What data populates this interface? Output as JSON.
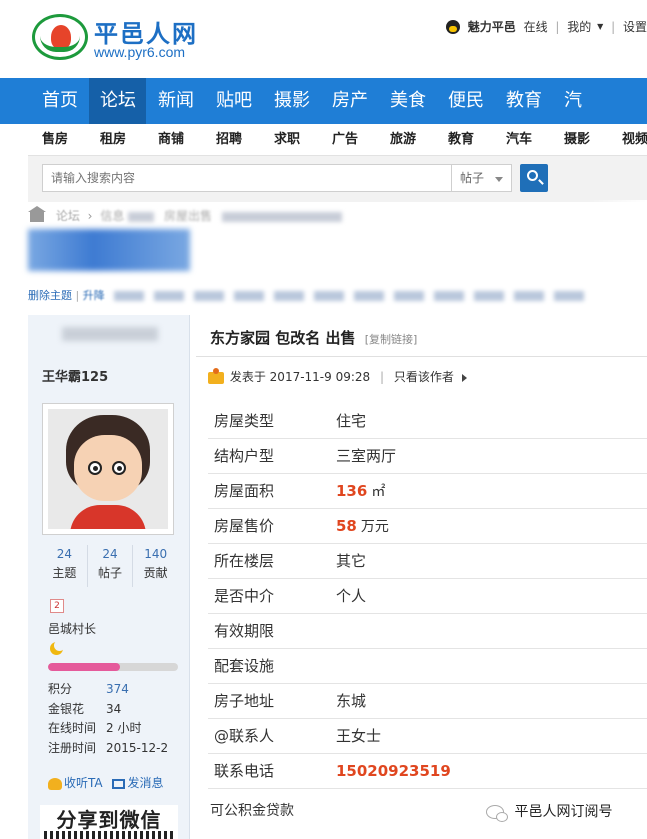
{
  "header": {
    "logo_name": "平邑人网",
    "logo_url": "www.pyr6.com",
    "topbar": {
      "user": "魅力平邑",
      "status": "在线",
      "mine": "我的",
      "settings": "设置"
    }
  },
  "mainnav": [
    "首页",
    "论坛",
    "新闻",
    "贴吧",
    "摄影",
    "房产",
    "美食",
    "便民",
    "教育",
    "汽"
  ],
  "mainnav_active": "论坛",
  "subnav": [
    "售房",
    "租房",
    "商铺",
    "招聘",
    "求职",
    "广告",
    "旅游",
    "教育",
    "汽车",
    "摄影",
    "视频"
  ],
  "search": {
    "placeholder": "请输入搜索内容",
    "scope": "帖子"
  },
  "breadcrumb": {
    "forum": "论坛",
    "section": "信息",
    "board": "房屋出售"
  },
  "manage": {
    "delete": "删除主题",
    "upgrade": "升降"
  },
  "user": {
    "name": "王华霸125",
    "stats": [
      {
        "num": "24",
        "label": "主题"
      },
      {
        "num": "24",
        "label": "帖子"
      },
      {
        "num": "140",
        "label": "贡献"
      }
    ],
    "level_badge": "2",
    "rank": "邑城村长",
    "level_progress": 0.55,
    "info": [
      {
        "k": "积分",
        "v": "374",
        "blue": true
      },
      {
        "k": "金银花",
        "v": "34",
        "blue": false
      },
      {
        "k": "在线时间",
        "v": "2 小时",
        "blue": false
      },
      {
        "k": "注册时间",
        "v": "2015-12-2",
        "blue": false
      }
    ],
    "follow": "收听TA",
    "message": "发消息",
    "wechat": "分享到微信"
  },
  "post": {
    "title": "东方家园 包改名 出售",
    "copy_link": "[复制链接]",
    "posted_prefix": "发表于",
    "posted_time": "2017-11-9 09:28",
    "author_only": "只看该作者",
    "fields": [
      {
        "k": "房屋类型",
        "v": "住宅",
        "red": false,
        "unit": ""
      },
      {
        "k": "结构户型",
        "v": "三室两厅",
        "red": false,
        "unit": ""
      },
      {
        "k": "房屋面积",
        "v": "136",
        "red": true,
        "unit": "㎡"
      },
      {
        "k": "房屋售价",
        "v": "58",
        "red": true,
        "unit": "万元"
      },
      {
        "k": "所在楼层",
        "v": "其它",
        "red": false,
        "unit": ""
      },
      {
        "k": "是否中介",
        "v": "个人",
        "red": false,
        "unit": ""
      },
      {
        "k": "有效期限",
        "v": "",
        "red": false,
        "unit": ""
      },
      {
        "k": "配套设施",
        "v": "",
        "red": false,
        "unit": ""
      },
      {
        "k": "房子地址",
        "v": "东城",
        "red": false,
        "unit": ""
      },
      {
        "k": "@联系人",
        "v": "王女士",
        "red": false,
        "unit": ""
      },
      {
        "k": "联系电话",
        "v": "15020923519",
        "red": true,
        "unit": ""
      }
    ],
    "note": "可公积金贷款"
  },
  "watermark": "平邑人网订阅号",
  "colors": {
    "nav_blue": "#1f7ed6",
    "nav_active": "#1560a8",
    "accent_red": "#e0461f",
    "link_blue": "#2a6bb6"
  }
}
